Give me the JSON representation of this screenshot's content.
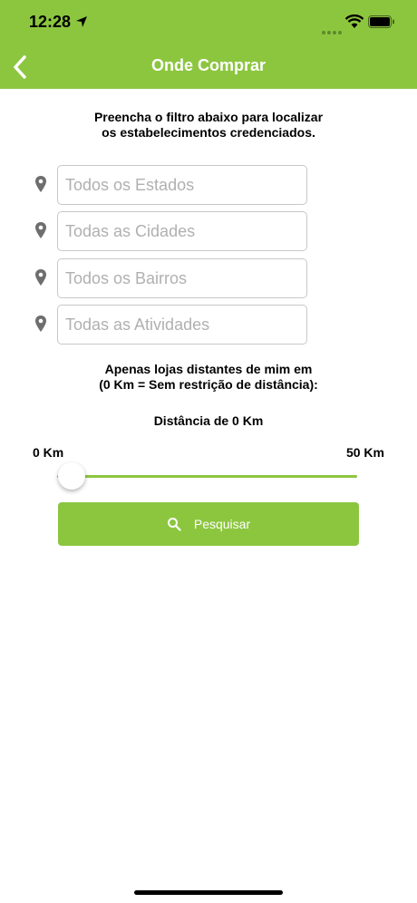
{
  "status_bar": {
    "time": "12:28"
  },
  "header": {
    "title": "Onde Comprar",
    "accent_color": "#8cc63f"
  },
  "instructions": "Preencha o filtro abaixo para localizar\nos estabelecimentos credenciados.",
  "fields": [
    {
      "placeholder": "Todos os Estados",
      "value": ""
    },
    {
      "placeholder": "Todas as Cidades",
      "value": ""
    },
    {
      "placeholder": "Todos os Bairros",
      "value": ""
    },
    {
      "placeholder": "Todas as Atividades",
      "value": ""
    }
  ],
  "distance": {
    "description": "Apenas lojas distantes de mim em\n(0 Km = Sem restrição de distância):",
    "current_label": "Distância de 0 Km",
    "min_label": "0 Km",
    "max_label": "50 Km",
    "value_km": 0,
    "min_km": 0,
    "max_km": 50
  },
  "search_button": {
    "label": "Pesquisar"
  },
  "icons": {
    "back": "chevron-left-icon",
    "field": "map-pin-icon",
    "search": "search-icon"
  }
}
